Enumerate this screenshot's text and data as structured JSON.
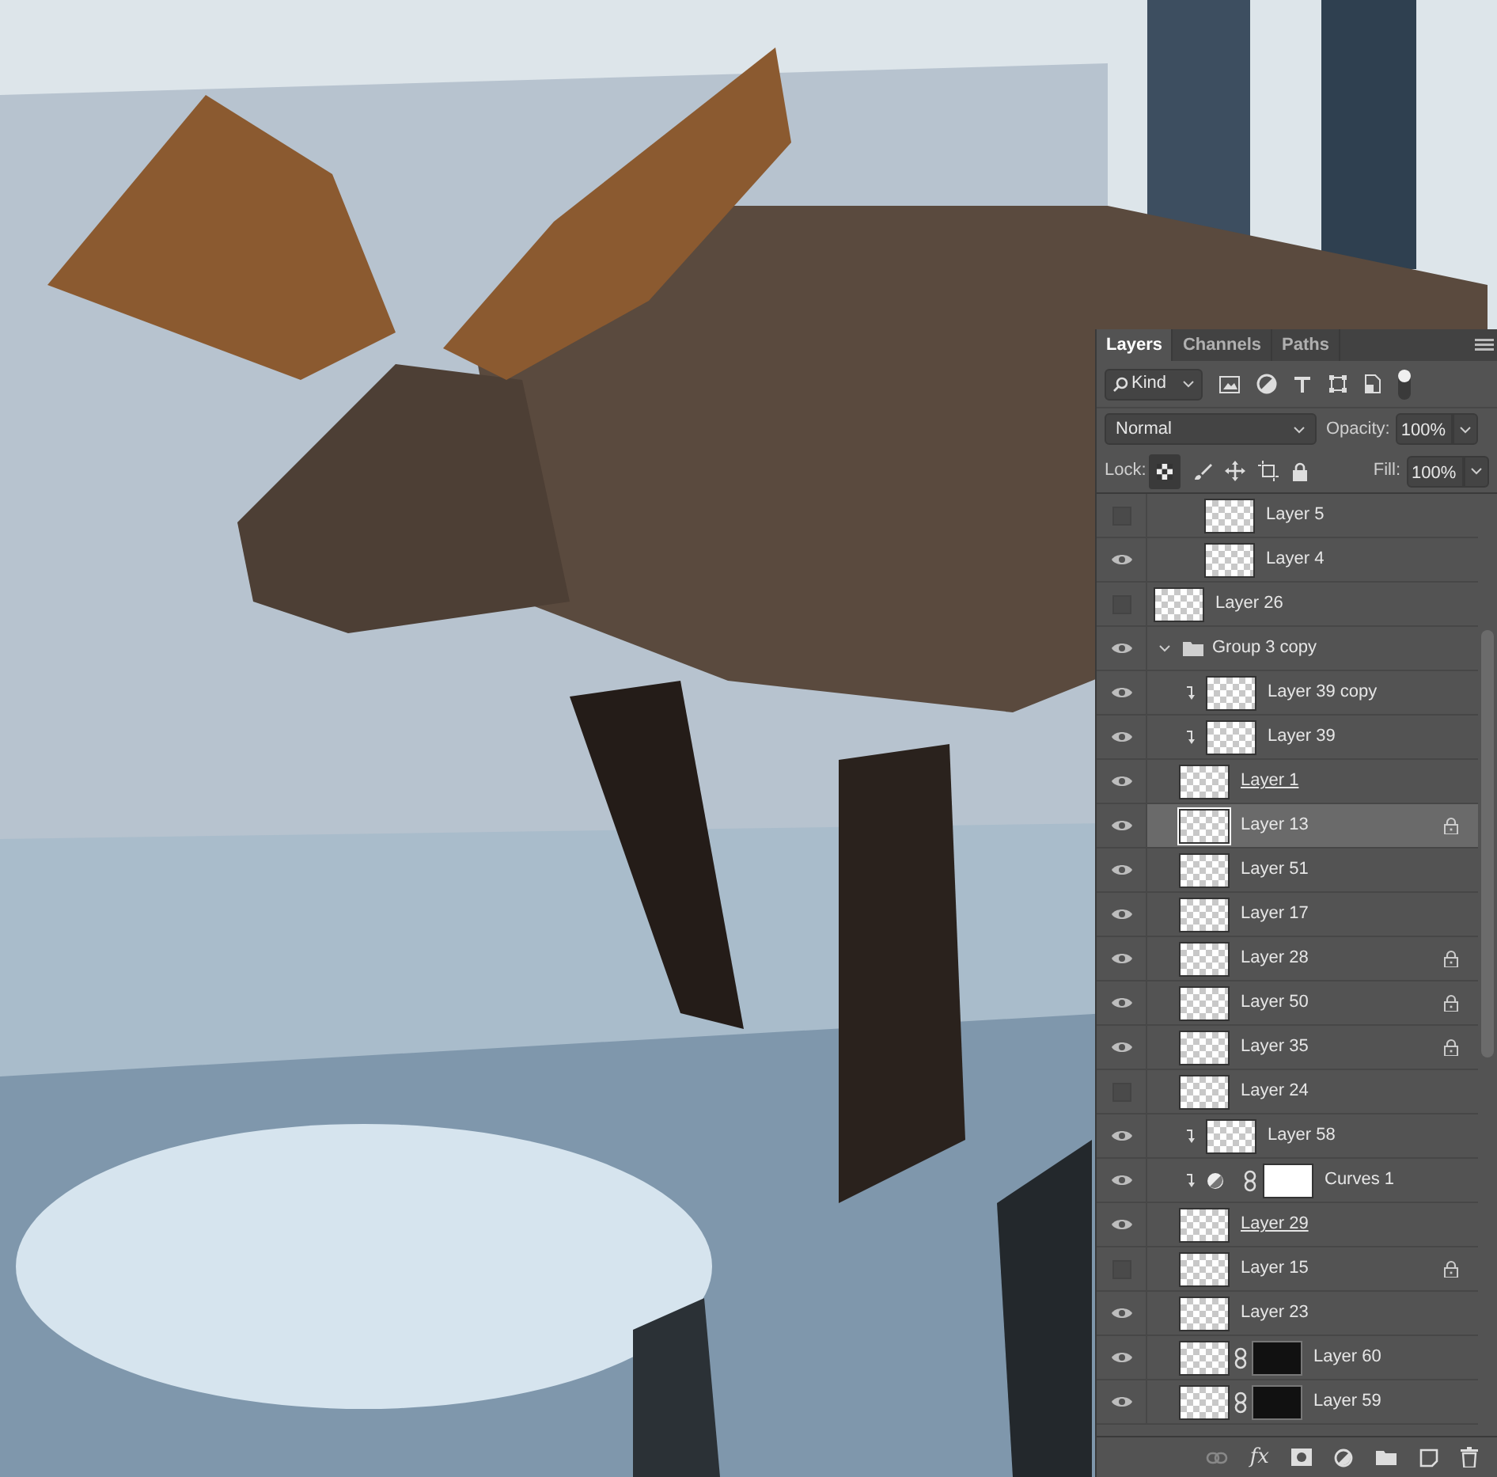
{
  "layers_panel": {
    "tabs": [
      {
        "label": "Layers",
        "selected": true
      },
      {
        "label": "Channels",
        "selected": false
      },
      {
        "label": "Paths",
        "selected": false
      }
    ],
    "filter": {
      "value": "Kind"
    },
    "blend_mode": {
      "value": "Normal"
    },
    "opacity": {
      "label": "Opacity:",
      "value": "100%"
    },
    "lock": {
      "label": "Lock:",
      "transparency_locked": true
    },
    "fill": {
      "label": "Fill:",
      "value": "100%"
    },
    "layers": [
      {
        "kind": "hidden_group",
        "children": [
          {
            "kind": "hidden_group",
            "children": [
              {
                "kind": "layer",
                "name": "Layer 5",
                "visible": false,
                "clipped": false,
                "locked": false,
                "underlined": false,
                "selected": false
              },
              {
                "kind": "layer",
                "name": "Layer 4",
                "visible": true,
                "clipped": false,
                "locked": false,
                "underlined": false,
                "selected": false
              }
            ]
          }
        ]
      },
      {
        "kind": "layer",
        "name": "Layer 26",
        "visible": false,
        "clipped": false,
        "locked": false,
        "underlined": false,
        "selected": false
      },
      {
        "kind": "group",
        "name": "Group 3 copy",
        "visible": true,
        "expanded": true,
        "selected": false,
        "children": [
          {
            "kind": "layer",
            "name": "Layer 39 copy",
            "visible": true,
            "clipped": true,
            "locked": false,
            "underlined": false,
            "selected": false
          },
          {
            "kind": "layer",
            "name": "Layer 39",
            "visible": true,
            "clipped": true,
            "locked": false,
            "underlined": false,
            "selected": false
          },
          {
            "kind": "layer",
            "name": "Layer 1",
            "visible": true,
            "clipped": false,
            "locked": false,
            "underlined": true,
            "selected": false
          },
          {
            "kind": "layer",
            "name": "Layer 13",
            "visible": true,
            "clipped": false,
            "locked": true,
            "underlined": false,
            "selected": true
          },
          {
            "kind": "layer",
            "name": "Layer 51",
            "visible": true,
            "clipped": false,
            "locked": false,
            "underlined": false,
            "selected": false
          },
          {
            "kind": "layer",
            "name": "Layer 17",
            "visible": true,
            "clipped": false,
            "locked": false,
            "underlined": false,
            "selected": false
          },
          {
            "kind": "layer",
            "name": "Layer 28",
            "visible": true,
            "clipped": false,
            "locked": true,
            "underlined": false,
            "selected": false
          },
          {
            "kind": "layer",
            "name": "Layer 50",
            "visible": true,
            "clipped": false,
            "locked": true,
            "underlined": false,
            "selected": false
          },
          {
            "kind": "layer",
            "name": "Layer 35",
            "visible": true,
            "clipped": false,
            "locked": true,
            "underlined": false,
            "selected": false
          },
          {
            "kind": "layer",
            "name": "Layer 24",
            "visible": false,
            "clipped": false,
            "locked": false,
            "underlined": false,
            "selected": false
          },
          {
            "kind": "layer",
            "name": "Layer 58",
            "visible": true,
            "clipped": true,
            "locked": false,
            "underlined": false,
            "selected": false
          },
          {
            "kind": "adjustment",
            "name": "Curves 1",
            "visible": true,
            "clipped": true,
            "locked": false,
            "underlined": false,
            "selected": false
          },
          {
            "kind": "layer",
            "name": "Layer 29",
            "visible": true,
            "clipped": false,
            "locked": false,
            "underlined": true,
            "selected": false
          },
          {
            "kind": "layer",
            "name": "Layer 15",
            "visible": false,
            "clipped": false,
            "locked": true,
            "underlined": false,
            "selected": false
          },
          {
            "kind": "layer",
            "name": "Layer 23",
            "visible": true,
            "clipped": false,
            "locked": false,
            "underlined": false,
            "selected": false
          },
          {
            "kind": "masked",
            "name": "Layer 60",
            "visible": true,
            "clipped": false,
            "locked": false,
            "underlined": false,
            "selected": false
          },
          {
            "kind": "masked",
            "name": "Layer 59",
            "visible": true,
            "clipped": false,
            "locked": false,
            "underlined": false,
            "selected": false
          }
        ]
      }
    ],
    "footer": {
      "effects": "fx"
    }
  }
}
